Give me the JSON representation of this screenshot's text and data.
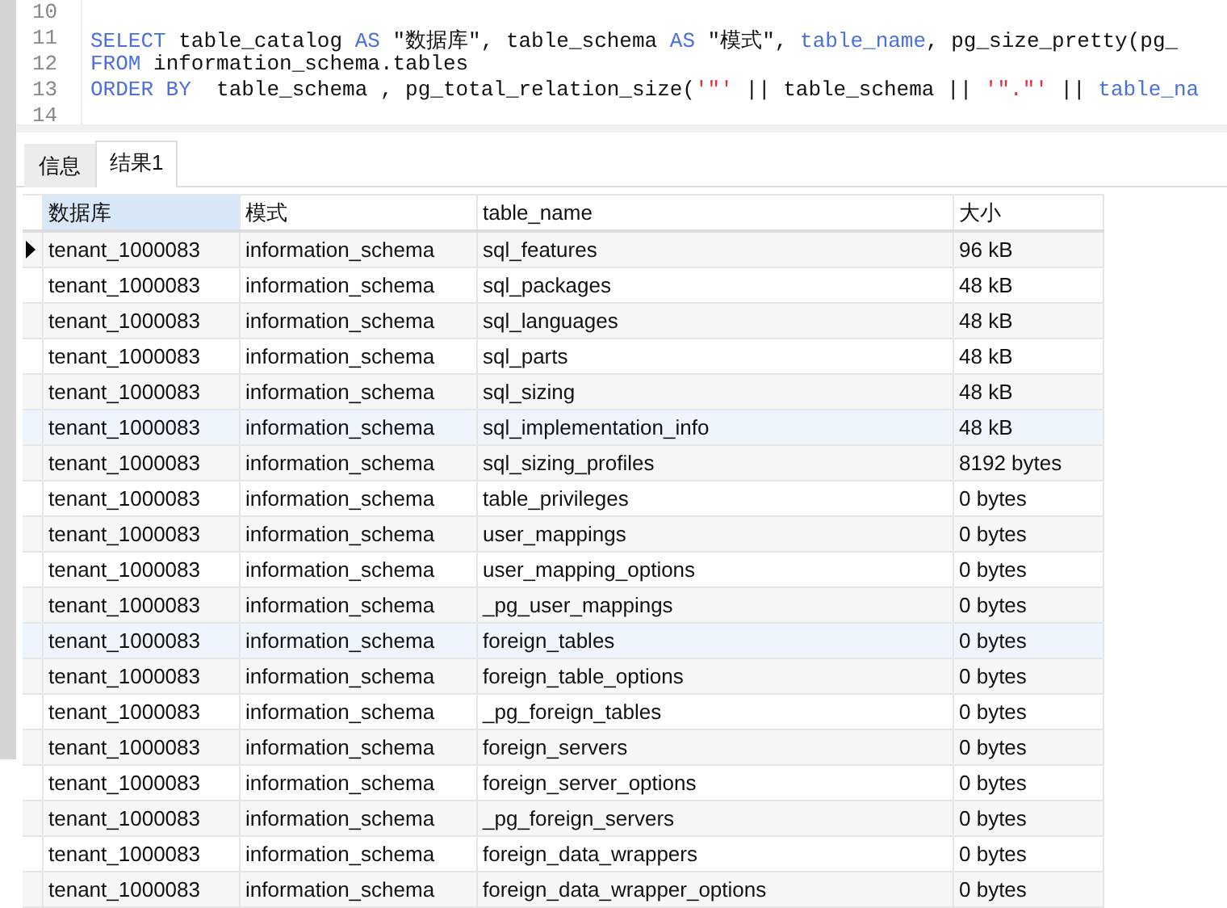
{
  "editor": {
    "lines": [
      {
        "number": "10"
      },
      {
        "number": "11",
        "tokens": [
          {
            "kind": "keyword",
            "text": "SELECT"
          },
          {
            "kind": "plain",
            "text": " table_catalog "
          },
          {
            "kind": "keyword",
            "text": "AS"
          },
          {
            "kind": "plain",
            "text": " \"数据库\", table_schema "
          },
          {
            "kind": "keyword",
            "text": "AS"
          },
          {
            "kind": "plain",
            "text": " \"模式\", "
          },
          {
            "kind": "keyword",
            "text": "table_name"
          },
          {
            "kind": "plain",
            "text": ", pg_size_pretty(pg_"
          }
        ]
      },
      {
        "number": "12",
        "tokens": [
          {
            "kind": "keyword",
            "text": "FROM"
          },
          {
            "kind": "plain",
            "text": " information_schema.tables"
          }
        ]
      },
      {
        "number": "13",
        "tokens": [
          {
            "kind": "keyword",
            "text": "ORDER BY"
          },
          {
            "kind": "plain",
            "text": "  table_schema , pg_total_relation_size("
          },
          {
            "kind": "string",
            "text": "'\"'"
          },
          {
            "kind": "plain",
            "text": " || table_schema || "
          },
          {
            "kind": "string",
            "text": "'\".\"'"
          },
          {
            "kind": "plain",
            "text": " || "
          },
          {
            "kind": "keyword",
            "text": "table_na"
          }
        ]
      },
      {
        "number": "14"
      }
    ]
  },
  "tabs": [
    {
      "label": "信息",
      "selected": false
    },
    {
      "label": "结果1",
      "selected": true
    }
  ],
  "table": {
    "columns": [
      "数据库",
      "模式",
      "table_name",
      "大小"
    ],
    "rows": [
      {
        "cells": [
          "tenant_1000083",
          "information_schema",
          "sql_features",
          "96 kB"
        ],
        "selected": true,
        "highlighted": false
      },
      {
        "cells": [
          "tenant_1000083",
          "information_schema",
          "sql_packages",
          "48 kB"
        ],
        "selected": false,
        "highlighted": false
      },
      {
        "cells": [
          "tenant_1000083",
          "information_schema",
          "sql_languages",
          "48 kB"
        ],
        "selected": false,
        "highlighted": false
      },
      {
        "cells": [
          "tenant_1000083",
          "information_schema",
          "sql_parts",
          "48 kB"
        ],
        "selected": false,
        "highlighted": false
      },
      {
        "cells": [
          "tenant_1000083",
          "information_schema",
          "sql_sizing",
          "48 kB"
        ],
        "selected": false,
        "highlighted": false
      },
      {
        "cells": [
          "tenant_1000083",
          "information_schema",
          "sql_implementation_info",
          "48 kB"
        ],
        "selected": false,
        "highlighted": true
      },
      {
        "cells": [
          "tenant_1000083",
          "information_schema",
          "sql_sizing_profiles",
          "8192 bytes"
        ],
        "selected": false,
        "highlighted": false
      },
      {
        "cells": [
          "tenant_1000083",
          "information_schema",
          "table_privileges",
          "0 bytes"
        ],
        "selected": false,
        "highlighted": false
      },
      {
        "cells": [
          "tenant_1000083",
          "information_schema",
          "user_mappings",
          "0 bytes"
        ],
        "selected": false,
        "highlighted": false
      },
      {
        "cells": [
          "tenant_1000083",
          "information_schema",
          "user_mapping_options",
          "0 bytes"
        ],
        "selected": false,
        "highlighted": false
      },
      {
        "cells": [
          "tenant_1000083",
          "information_schema",
          "_pg_user_mappings",
          "0 bytes"
        ],
        "selected": false,
        "highlighted": false
      },
      {
        "cells": [
          "tenant_1000083",
          "information_schema",
          "foreign_tables",
          "0 bytes"
        ],
        "selected": false,
        "highlighted": true
      },
      {
        "cells": [
          "tenant_1000083",
          "information_schema",
          "foreign_table_options",
          "0 bytes"
        ],
        "selected": false,
        "highlighted": false
      },
      {
        "cells": [
          "tenant_1000083",
          "information_schema",
          "_pg_foreign_tables",
          "0 bytes"
        ],
        "selected": false,
        "highlighted": false
      },
      {
        "cells": [
          "tenant_1000083",
          "information_schema",
          "foreign_servers",
          "0 bytes"
        ],
        "selected": false,
        "highlighted": false
      },
      {
        "cells": [
          "tenant_1000083",
          "information_schema",
          "foreign_server_options",
          "0 bytes"
        ],
        "selected": false,
        "highlighted": false
      },
      {
        "cells": [
          "tenant_1000083",
          "information_schema",
          "_pg_foreign_servers",
          "0 bytes"
        ],
        "selected": false,
        "highlighted": false
      },
      {
        "cells": [
          "tenant_1000083",
          "information_schema",
          "foreign_data_wrappers",
          "0 bytes"
        ],
        "selected": false,
        "highlighted": false
      },
      {
        "cells": [
          "tenant_1000083",
          "information_schema",
          "foreign_data_wrapper_options",
          "0 bytes"
        ],
        "selected": false,
        "highlighted": false
      }
    ]
  }
}
